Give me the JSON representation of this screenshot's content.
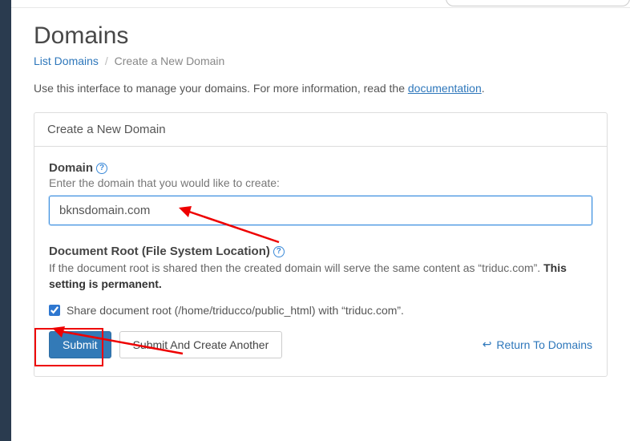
{
  "page": {
    "title": "Domains",
    "breadcrumb": {
      "list": "List Domains",
      "current": "Create a New Domain"
    },
    "intro_prefix": "Use this interface to manage your domains. For more information, read the ",
    "intro_link": "documentation",
    "intro_suffix": "."
  },
  "panel": {
    "header": "Create a New Domain",
    "domain": {
      "label": "Domain",
      "help": "Enter the domain that you would like to create:",
      "value": "bknsdomain.com"
    },
    "docroot": {
      "label": "Document Root (File System Location)",
      "desc_prefix": "If the document root is shared then the created domain will serve the same content as “triduc.com”. ",
      "desc_bold": "This setting is permanent.",
      "checkbox_label": "Share document root (/home/triducco/public_html) with “triduc.com”.",
      "checked": true
    },
    "actions": {
      "submit": "Submit",
      "submit_another": "Submit And Create Another",
      "return": "Return To Domains"
    }
  }
}
